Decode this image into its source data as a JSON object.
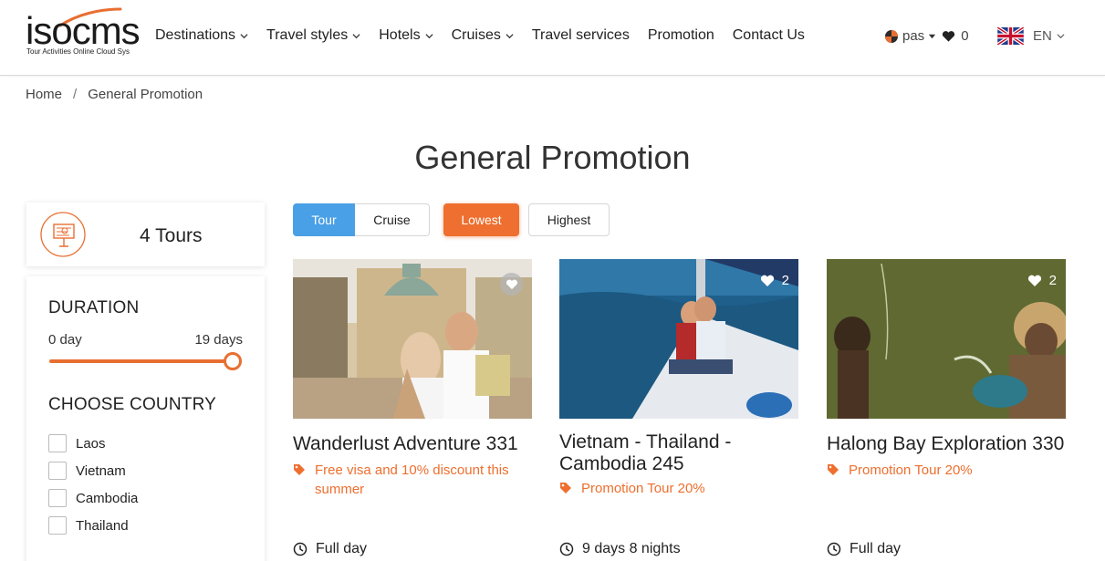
{
  "brand": {
    "name": "isocms",
    "tagline": "Tour Activities Online Cloud Sys"
  },
  "nav": [
    {
      "label": "Destinations",
      "has_dropdown": true
    },
    {
      "label": "Travel styles",
      "has_dropdown": true
    },
    {
      "label": "Hotels",
      "has_dropdown": true
    },
    {
      "label": "Cruises",
      "has_dropdown": true
    },
    {
      "label": "Travel services",
      "has_dropdown": false
    },
    {
      "label": "Promotion",
      "has_dropdown": false
    },
    {
      "label": "Contact Us",
      "has_dropdown": false
    }
  ],
  "user": {
    "name": "pas",
    "wishlist_count": "0"
  },
  "language": {
    "code": "EN"
  },
  "breadcrumb": {
    "home": "Home",
    "separator": "/",
    "current": "General Promotion"
  },
  "page_title": "General Promotion",
  "summary": {
    "count_label": "4 Tours"
  },
  "filters": {
    "duration_heading": "DURATION",
    "duration_min": "0 day",
    "duration_max": "19 days",
    "duration_slider_fraction": 1.0,
    "country_heading": "CHOOSE COUNTRY",
    "countries": [
      "Laos",
      "Vietnam",
      "Cambodia",
      "Thailand"
    ]
  },
  "type_toggle": {
    "tour": "Tour",
    "cruise": "Cruise",
    "selected": "Tour"
  },
  "sort_toggle": {
    "lowest": "Lowest",
    "highest": "Highest",
    "selected": "Lowest"
  },
  "cards": [
    {
      "title": "Wanderlust Adventure 331",
      "promo": "Free visa and 10% discount this summer",
      "favorites": "",
      "duration": "Full day"
    },
    {
      "title": "Vietnam - Thailand - Cambodia 245",
      "promo": "Promotion Tour 20%",
      "favorites": "2",
      "duration": "9 days 8 nights"
    },
    {
      "title": "Halong Bay Exploration 330",
      "promo": "Promotion Tour 20%",
      "favorites": "2",
      "duration": "Full day"
    }
  ],
  "colors": {
    "accent": "#ee6f2f",
    "tab_active": "#4aa0e6"
  },
  "icons": [
    "chevron-down-icon",
    "heart-icon",
    "tag-icon",
    "clock-icon",
    "uk-flag-icon",
    "map-board-icon"
  ]
}
